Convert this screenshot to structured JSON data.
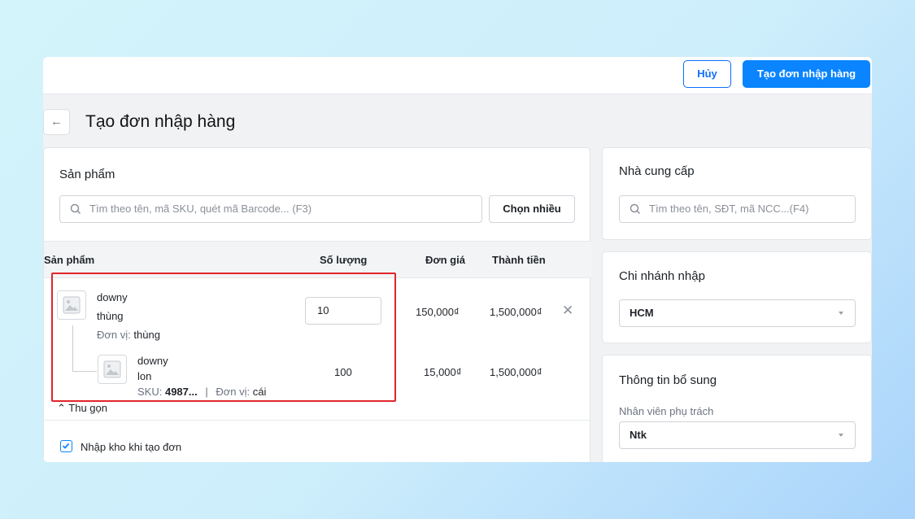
{
  "header": {
    "cancel_label": "Hủy",
    "create_label": "Tạo đơn nhập hàng"
  },
  "page": {
    "back_icon": "arrow-left-icon",
    "title": "Tạo đơn nhập hàng"
  },
  "products_card": {
    "title": "Sản phẩm",
    "search_placeholder": "Tìm theo tên, mã SKU, quét mã Barcode... (F3)",
    "choose_many_label": "Chọn nhiều",
    "columns": {
      "product": "Sản phẩm",
      "quantity": "Số lượng",
      "unit_price": "Đơn giá",
      "total": "Thành tiền"
    },
    "row": {
      "name": "downy",
      "variant": "thùng",
      "unit_label": "Đơn vị:",
      "unit_value": "thùng",
      "quantity": "10",
      "unit_price": "150,000₫",
      "total": "1,500,000₫",
      "child": {
        "name": "downy",
        "variant": "lon",
        "sku_label": "SKU:",
        "sku_value": "4987...",
        "unit_label": "Đơn vị:",
        "unit_value": "cái",
        "quantity": "100",
        "unit_price": "15,000₫",
        "total": "1,500,000₫"
      }
    },
    "collapse_label": "Thu gọn",
    "stock_checkbox_label": "Nhập kho khi tạo đơn",
    "stock_checkbox_checked": true
  },
  "supplier_card": {
    "title": "Nhà cung cấp",
    "search_placeholder": "Tìm theo tên, SĐT, mã NCC...(F4)"
  },
  "branch_card": {
    "title": "Chi nhánh nhập",
    "selected": "HCM"
  },
  "extra_card": {
    "title": "Thông tin bổ sung",
    "staff_label": "Nhân viên phụ trách",
    "staff_selected": "Ntk"
  },
  "colors": {
    "accent": "#0a84ff",
    "highlight": "#e0262a"
  }
}
